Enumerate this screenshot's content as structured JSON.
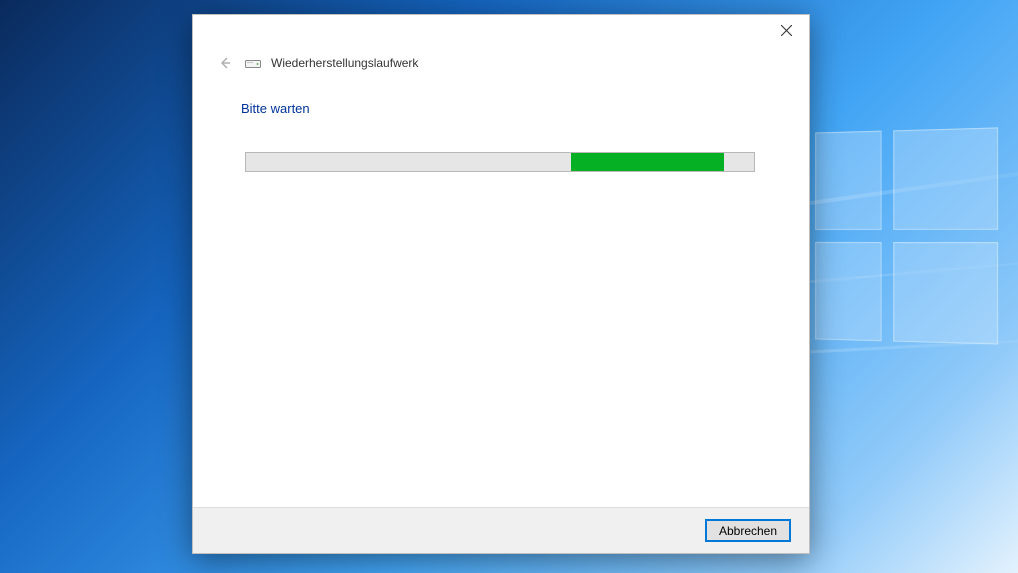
{
  "wizard": {
    "title": "Wiederherstellungslaufwerk",
    "heading": "Bitte warten",
    "cancel_label": "Abbrechen"
  },
  "progress": {
    "mode": "marquee",
    "chunk_start_pct": 64,
    "chunk_width_pct": 30
  },
  "colors": {
    "progress_green": "#06b025",
    "heading_blue": "#003399",
    "button_focus": "#0078d7"
  }
}
